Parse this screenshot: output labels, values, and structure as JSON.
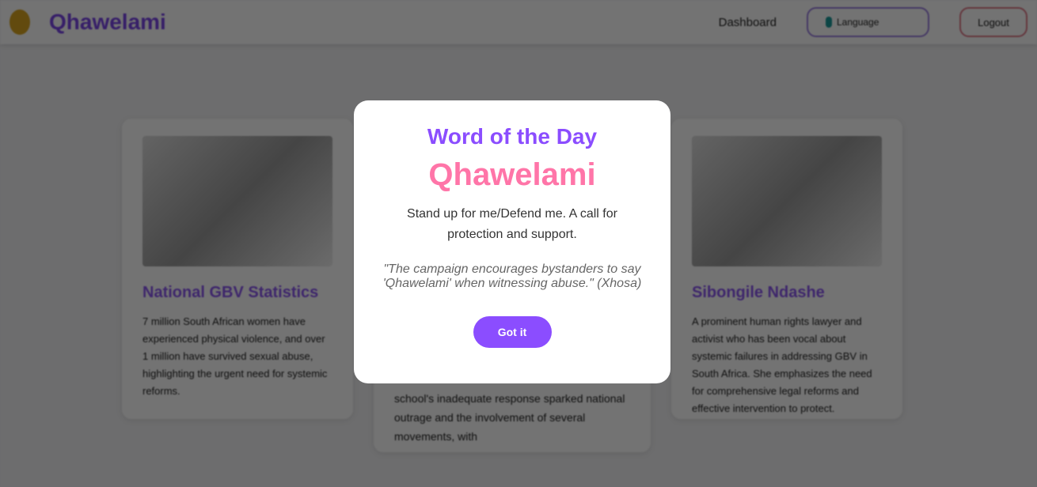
{
  "nav": {
    "brand": "Qhawelami",
    "dashboard": "Dashboard",
    "language": "Language",
    "logout": "Logout"
  },
  "cards": [
    {
      "title": "National GBV Statistics",
      "body": "7 million South African women have experienced physical violence, and over 1 million have survived sexual abuse, highlighting the urgent need for systemic reforms."
    },
    {
      "title": "",
      "body": "school's inadequate response sparked national outrage and the involvement of several movements, with"
    },
    {
      "title": "Sibongile Ndashe",
      "body": "A prominent human rights lawyer and activist who has been vocal about systemic failures in addressing GBV in South Africa. She emphasizes the need for comprehensive legal reforms and effective intervention to protect."
    }
  ],
  "modal": {
    "title": "Word of the Day",
    "word": "Qhawelami",
    "definition": "Stand up for me/Defend me. A call for protection and support.",
    "quote": "\"The campaign encourages bystanders to say 'Qhawelami' when witnessing abuse.\" (Xhosa)",
    "button": "Got it"
  }
}
